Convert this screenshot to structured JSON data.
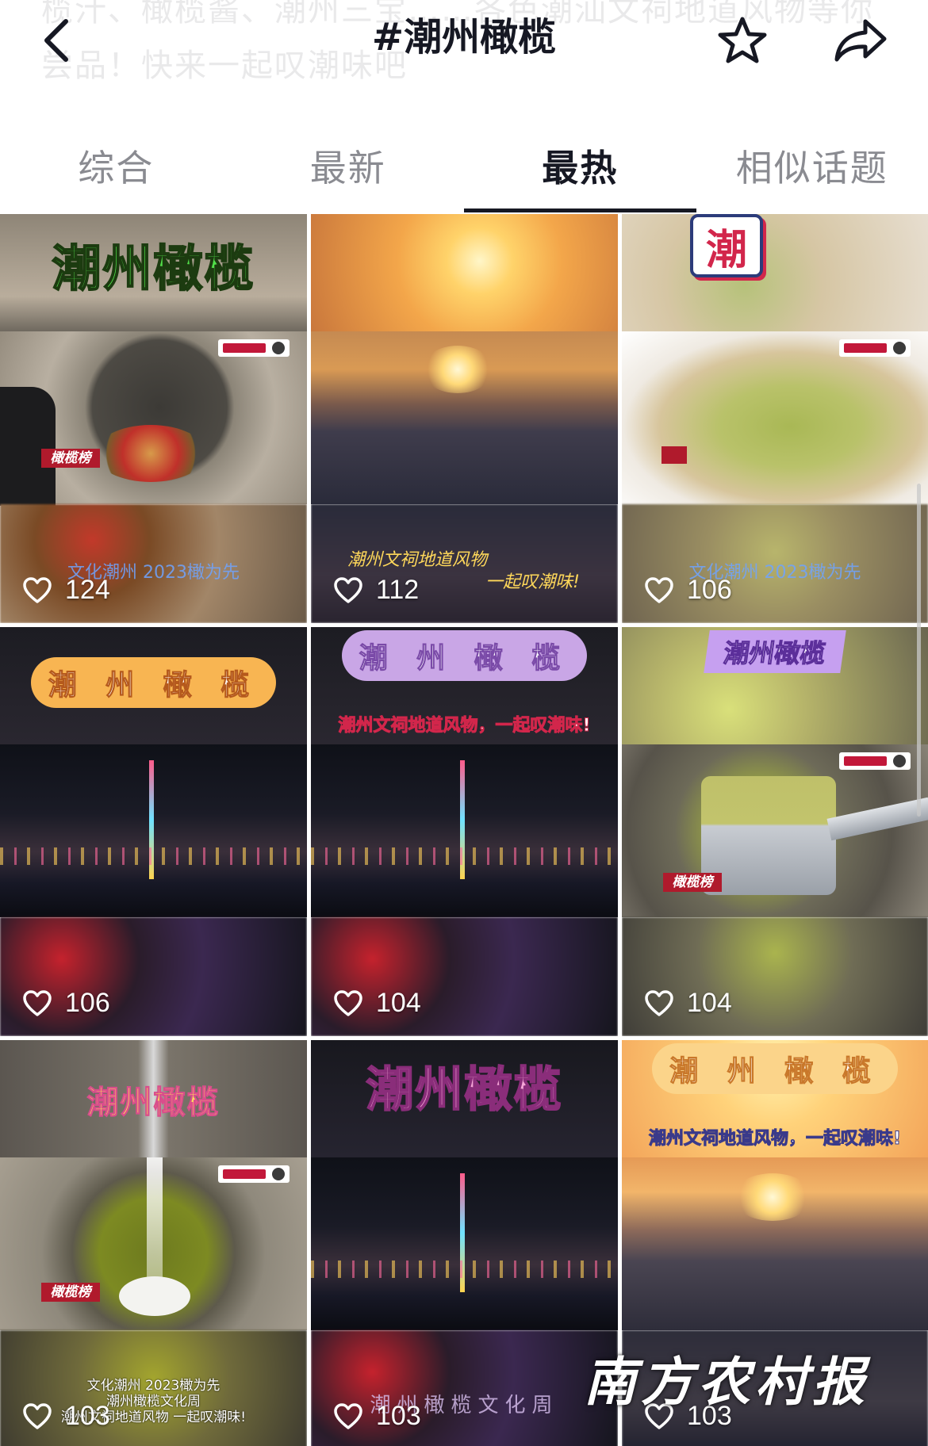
{
  "header": {
    "title": "#潮州橄榄",
    "ghost_description": "榄汁、橄榄酱、潮州三宝……各色潮汕文祠地道风物等你尝品！快来一起叹潮味吧"
  },
  "tabs": [
    {
      "label": "综合",
      "active": false
    },
    {
      "label": "最新",
      "active": false
    },
    {
      "label": "最热",
      "active": true
    },
    {
      "label": "相似话题",
      "active": false
    }
  ],
  "videos": [
    {
      "likes": "124",
      "overlay_title": "潮州橄榄",
      "overlay_logo": "橄榄榜",
      "caption": "文化潮州 2023橄为先"
    },
    {
      "likes": "112",
      "caption_line1": "潮州文祠地道风物",
      "caption_line2": "一起叹潮味!"
    },
    {
      "likes": "106",
      "overlay_title": "潮",
      "caption": "文化潮州 2023橄为先"
    },
    {
      "likes": "106",
      "overlay_title": "潮 州 橄 榄"
    },
    {
      "likes": "104",
      "overlay_title": "潮 州 橄 榄",
      "subtitle": "潮州文祠地道风物，一起叹潮味!"
    },
    {
      "likes": "104",
      "overlay_title": "潮州橄榄",
      "overlay_logo": "橄榄榜"
    },
    {
      "likes": "103",
      "overlay_title": "潮州橄榄",
      "overlay_logo": "橄榄榜",
      "caption_line1": "文化潮州 2023橄为先",
      "caption_line2": "潮州橄榄文化周",
      "caption_line3": "潮州文祠地道风物 一起叹潮味!"
    },
    {
      "likes": "103",
      "overlay_title": "潮州橄榄",
      "caption": "潮州橄榄文化周"
    },
    {
      "likes": "103",
      "overlay_title": "潮 州 橄 榄",
      "subtitle": "潮州文祠地道风物，一起叹潮味!"
    }
  ],
  "watermark": "南方农村报",
  "icons": {
    "back": "chevron-left-icon",
    "favorite": "star-outline-icon",
    "share": "share-arrow-icon",
    "like": "heart-outline-icon"
  }
}
